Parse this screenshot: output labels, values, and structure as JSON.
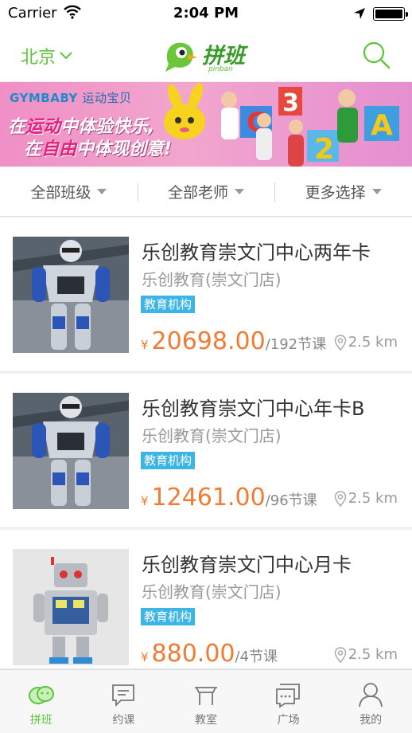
{
  "status_bar": {
    "carrier": "Carrier",
    "time": "2:04 PM",
    "icons": [
      "wifi-icon",
      "location-icon",
      "battery-icon"
    ]
  },
  "nav": {
    "city": "北京",
    "logo_text": "拼班",
    "logo_sub": "pinban",
    "search_icon": "search-icon",
    "accent_color": "#5cc53c"
  },
  "banner": {
    "brand": "GYMBABY",
    "brand_cn": "运动宝贝",
    "line1_a": "在",
    "line1_hl": "运动",
    "line1_b": "中体验快乐,",
    "line2_a": "在",
    "line2_hl": "自由",
    "line2_b": "中体现创意!"
  },
  "filters": [
    {
      "label": "全部班级"
    },
    {
      "label": "全部老师"
    },
    {
      "label": "更多选择"
    }
  ],
  "courses": [
    {
      "title": "乐创教育崇文门中心两年卡",
      "org": "乐创教育(崇文门店)",
      "tag": "教育机构",
      "currency": "¥",
      "price": "20698.00",
      "lessons": "/192节课",
      "distance": "2.5 km",
      "thumb": "humanoid-robot"
    },
    {
      "title": "乐创教育崇文门中心年卡B",
      "org": "乐创教育(崇文门店)",
      "tag": "教育机构",
      "currency": "¥",
      "price": "12461.00",
      "lessons": "/96节课",
      "distance": "2.5 km",
      "thumb": "humanoid-robot"
    },
    {
      "title": "乐创教育崇文门中心月卡",
      "org": "乐创教育(崇文门店)",
      "tag": "教育机构",
      "currency": "¥",
      "price": "880.00",
      "lessons": "/4节课",
      "distance": "2.5 km",
      "thumb": "toy-robot"
    }
  ],
  "tabs": [
    {
      "label": "拼班",
      "icon": "pinban-icon",
      "active": true
    },
    {
      "label": "约课",
      "icon": "chat-icon",
      "active": false
    },
    {
      "label": "教室",
      "icon": "desk-icon",
      "active": false
    },
    {
      "label": "广场",
      "icon": "square-chat-icon",
      "active": false
    },
    {
      "label": "我的",
      "icon": "user-icon",
      "active": false
    }
  ]
}
